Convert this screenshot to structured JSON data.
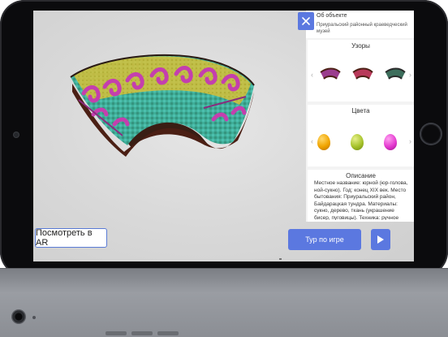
{
  "panel": {
    "about_title": "Об объекте",
    "museum_name": "Приуральский районный краеведческий музей",
    "patterns_title": "Узоры",
    "colors_title": "Цвета",
    "description_title": "Описание",
    "description_text": "Местное название: юрной (юр-голова, ной-сукно). Год: конец XIX век. Место бытования: Приуральский район, Байдарацкая тундра. Материалы: сукно, дерево, ткань (украшение бисер, пуговицы). Техника: ручное шитьё."
  },
  "colors": {
    "accent": "#5b78e0",
    "egg_swatches": [
      "orange-egg",
      "olive-green-egg",
      "magenta-egg"
    ]
  },
  "buttons": {
    "ar_label": "Посмотреть в AR",
    "tour_label": "Тур по игре",
    "play_icon": "play-icon",
    "close_icon": "close-icon"
  }
}
